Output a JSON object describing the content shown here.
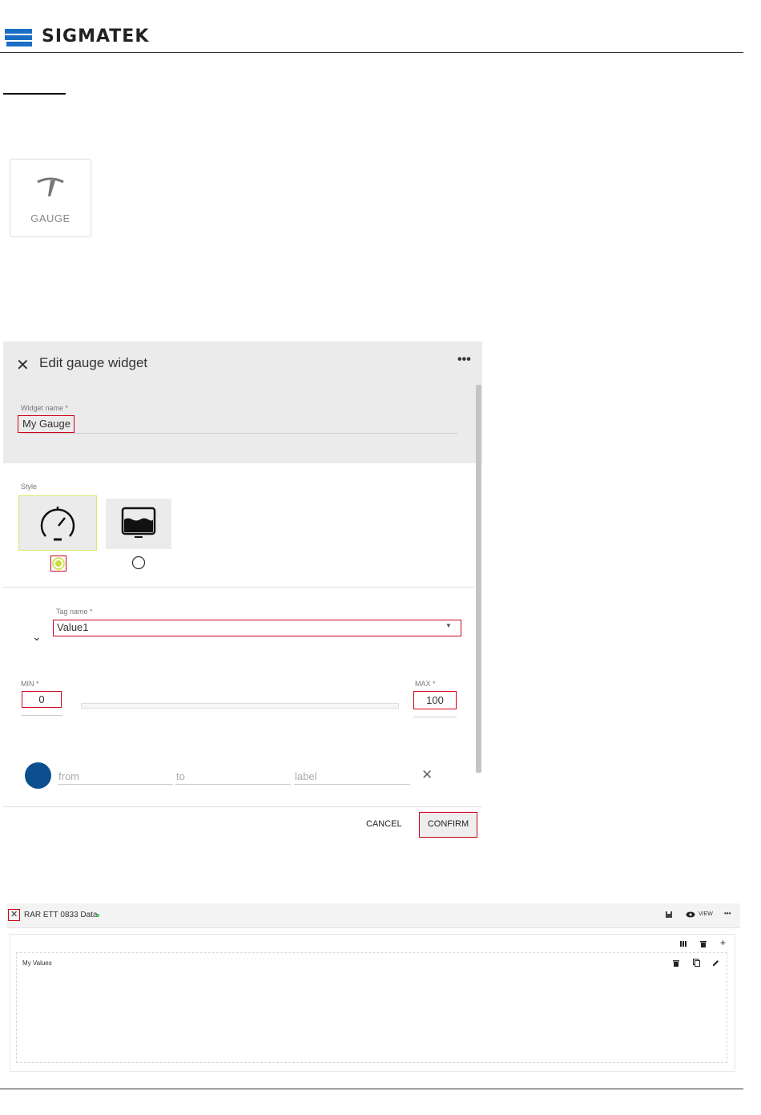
{
  "header": {
    "brand": "SIGMATEK"
  },
  "gauge_tile": {
    "label": "GAUGE"
  },
  "dialog": {
    "title": "Edit gauge widget",
    "more": "•••",
    "widget_name_label": "Widget name *",
    "widget_name_value": "My Gauge",
    "style_label": "Style",
    "tag_name_label": "Tag name *",
    "tag_name_value": "Value1",
    "min_label": "MIN *",
    "min_value": "0",
    "max_label": "MAX *",
    "max_value": "100",
    "range_color": "#0b4f8f",
    "from_placeholder": "from",
    "to_placeholder": "to",
    "label_placeholder": "label",
    "cancel": "CANCEL",
    "confirm": "CONFIRM"
  },
  "app": {
    "title": "RAR ETT 0833 Data",
    "view": "VIEW",
    "more": "•••",
    "panel_title": "My Values"
  },
  "colors": {
    "brand_blue": "#1a6fc4",
    "highlight_red": "#d0021b",
    "selected_green": "#c6e03a"
  }
}
